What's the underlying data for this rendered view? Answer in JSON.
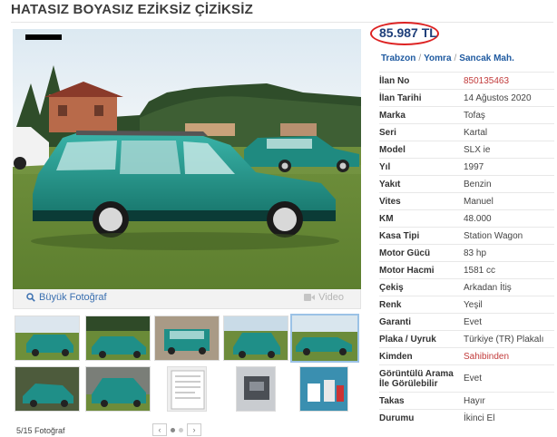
{
  "header": {
    "title": "HATASIZ BOYASIZ EZİKSİZ ÇİZİKSİZ"
  },
  "price": "85.987 TL",
  "location": {
    "city": "Trabzon",
    "district": "Yomra",
    "neighborhood": "Sancak Mah."
  },
  "gallery": {
    "big_photo_label": "Büyük Fotoğraf",
    "video_label": "Video",
    "counter": "5/15 Fotoğraf",
    "prev_label": "‹",
    "next_label": "›",
    "car_color": "#1f8f88",
    "thumbnails": [
      {
        "label": "green wagon on grass"
      },
      {
        "label": "green wagon side"
      },
      {
        "label": "green sedan front"
      },
      {
        "label": "green wagon rear"
      },
      {
        "label": "green wagon side active"
      },
      {
        "label": "green wagon rear view"
      },
      {
        "label": "green wagon three quarter"
      },
      {
        "label": "document paper"
      },
      {
        "label": "engine bay"
      },
      {
        "label": "keys and papers"
      }
    ]
  },
  "specs": [
    {
      "label": "İlan No",
      "value": "850135463",
      "highlight": true
    },
    {
      "label": "İlan Tarihi",
      "value": "14 Ağustos 2020"
    },
    {
      "label": "Marka",
      "value": "Tofaş"
    },
    {
      "label": "Seri",
      "value": "Kartal"
    },
    {
      "label": "Model",
      "value": "SLX ie"
    },
    {
      "label": "Yıl",
      "value": "1997"
    },
    {
      "label": "Yakıt",
      "value": "Benzin"
    },
    {
      "label": "Vites",
      "value": "Manuel"
    },
    {
      "label": "KM",
      "value": "48.000"
    },
    {
      "label": "Kasa Tipi",
      "value": "Station Wagon"
    },
    {
      "label": "Motor Gücü",
      "value": "83 hp"
    },
    {
      "label": "Motor Hacmi",
      "value": "1581 cc"
    },
    {
      "label": "Çekiş",
      "value": "Arkadan İtiş"
    },
    {
      "label": "Renk",
      "value": "Yeşil"
    },
    {
      "label": "Garanti",
      "value": "Evet"
    },
    {
      "label": "Plaka / Uyruk",
      "value": "Türkiye (TR) Plakalı"
    },
    {
      "label": "Kimden",
      "value": "Sahibinden",
      "highlight": true
    },
    {
      "label": "Görüntülü Arama İle Görülebilir",
      "value": "Evet"
    },
    {
      "label": "Takas",
      "value": "Hayır"
    },
    {
      "label": "Durumu",
      "value": "İkinci El"
    }
  ],
  "colors": {
    "accent_red": "#d22222",
    "link_blue": "#1f5aa0",
    "price_blue": "#1f3f7a"
  }
}
